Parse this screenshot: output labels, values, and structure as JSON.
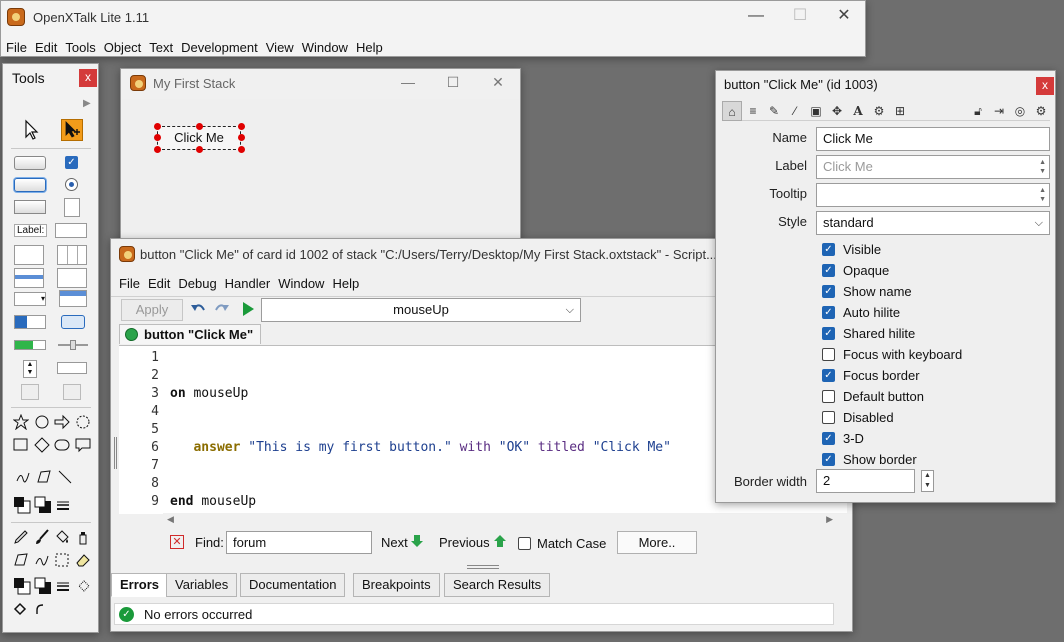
{
  "main_window": {
    "title": "OpenXTalk Lite 1.11",
    "controls": {
      "minimize": "—",
      "maximize": "☐",
      "close": "✕"
    },
    "menu": [
      "File",
      "Edit",
      "Tools",
      "Object",
      "Text",
      "Development",
      "View",
      "Window",
      "Help"
    ]
  },
  "tools_palette": {
    "title": "Tools",
    "close": "x",
    "label_tool": "Label:"
  },
  "stack_window": {
    "title": "My First Stack",
    "controls": {
      "minimize": "—",
      "maximize": "☐",
      "close": "✕"
    },
    "button_label": "Click Me"
  },
  "script_editor": {
    "title": "button \"Click Me\" of card id 1002 of stack \"C:/Users/Terry/Desktop/My First Stack.oxtstack\" - Script...",
    "menu": [
      "File",
      "Edit",
      "Debug",
      "Handler",
      "Window",
      "Help"
    ],
    "apply_label": "Apply",
    "handler_select": "mouseUp",
    "object_label": "button \"Click Me\"",
    "line_numbers": [
      "1",
      "2",
      "3",
      "4",
      "5",
      "6",
      "7",
      "8",
      "9"
    ],
    "code": {
      "line1_kw": "on",
      "line1_name": "mouseUp",
      "line2_cmd": "answer",
      "line2_str1": "\"This is my first button.\"",
      "line2_with": "with",
      "line2_str2": "\"OK\"",
      "line2_titled": "titled",
      "line2_str3": "\"Click Me\"",
      "line3_kw": "end",
      "line3_name": "mouseUp"
    },
    "find": {
      "label": "Find:",
      "value": "forum",
      "next": "Next",
      "previous": "Previous",
      "match_case": "Match Case",
      "more": "More.."
    },
    "tabs": [
      "Errors",
      "Variables",
      "Documentation",
      "Breakpoints",
      "Search Results"
    ],
    "status": "No errors occurred"
  },
  "inspector": {
    "title": "button \"Click Me\" (id 1003)",
    "close": "x",
    "fields": {
      "name_label": "Name",
      "name_value": "Click Me",
      "label_label": "Label",
      "label_placeholder": "Click Me",
      "tooltip_label": "Tooltip",
      "style_label": "Style",
      "style_value": "standard",
      "border_width_label": "Border width",
      "border_width_value": "2"
    },
    "checkboxes": [
      {
        "label": "Visible",
        "checked": true
      },
      {
        "label": "Opaque",
        "checked": true
      },
      {
        "label": "Show name",
        "checked": true
      },
      {
        "label": "Auto hilite",
        "checked": true
      },
      {
        "label": "Shared hilite",
        "checked": true
      },
      {
        "label": "Focus with keyboard",
        "checked": false
      },
      {
        "label": "Focus border",
        "checked": true
      },
      {
        "label": "Default button",
        "checked": false
      },
      {
        "label": "Disabled",
        "checked": false
      },
      {
        "label": "3-D",
        "checked": true
      },
      {
        "label": "Show border",
        "checked": true
      }
    ]
  },
  "colors": {
    "desktop": "#6e6e6e",
    "accent": "#1e64b4",
    "selection_handle": "#e00000",
    "success": "#1a9a3a",
    "error_red": "#d02a2a"
  }
}
